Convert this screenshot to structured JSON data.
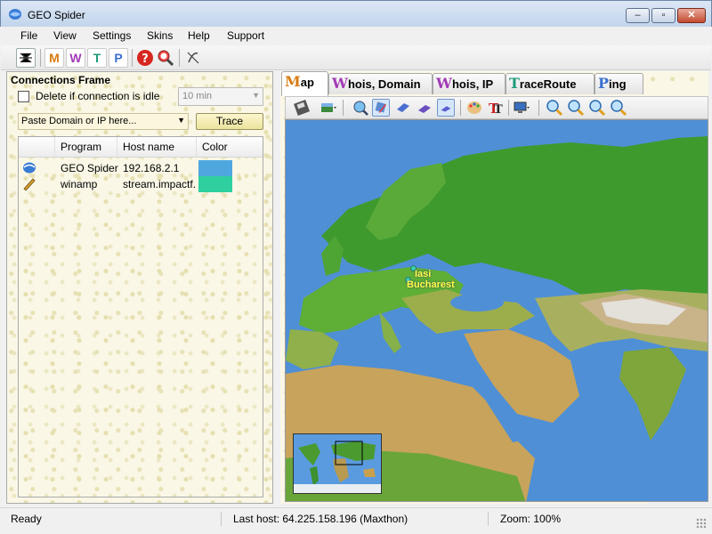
{
  "window": {
    "title": "GEO Spider"
  },
  "menu": [
    "File",
    "View",
    "Settings",
    "Skins",
    "Help",
    "Support"
  ],
  "toolbar": {
    "letter_buttons": [
      {
        "letter": "M",
        "color": "#d87a12"
      },
      {
        "letter": "W",
        "color": "#a23bb5"
      },
      {
        "letter": "T",
        "color": "#1f9a7a"
      },
      {
        "letter": "P",
        "color": "#3a6fd0"
      }
    ]
  },
  "connections": {
    "title": "Connections Frame",
    "delete_idle_label": "Delete if connection is idle",
    "idle_value": "10 min",
    "domain_placeholder": "Paste Domain or IP here...",
    "trace_label": "Trace",
    "columns": [
      "",
      "Program",
      "Host name",
      "Color"
    ],
    "rows": [
      {
        "program": "GEO Spider",
        "host": "192.168.2.1",
        "color": "#4fa7e0"
      },
      {
        "program": "winamp",
        "host": "stream.impactf...",
        "color": "#2fcfa0"
      }
    ]
  },
  "tabs": [
    {
      "cap": "M",
      "rest": "ap",
      "color": "#d87a12"
    },
    {
      "cap": "W",
      "rest": "hois, Domain",
      "color": "#a23bb5"
    },
    {
      "cap": "W",
      "rest": "hois, IP",
      "color": "#a23bb5"
    },
    {
      "cap": "T",
      "rest": "raceRoute",
      "color": "#1f9a7a"
    },
    {
      "cap": "P",
      "rest": "ing",
      "color": "#3a6fd0"
    }
  ],
  "map": {
    "cities": [
      "Iasi",
      "Bucharest"
    ]
  },
  "status": {
    "ready": "Ready",
    "last_host": "Last host: 64.225.158.196 (Maxthon)",
    "zoom": "Zoom: 100%"
  }
}
